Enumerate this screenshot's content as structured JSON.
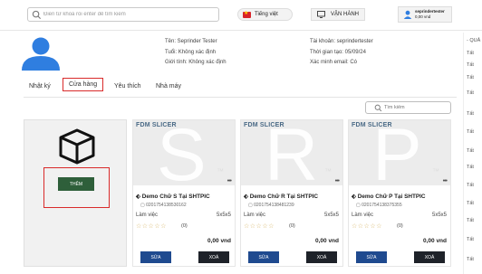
{
  "topbar": {
    "search_placeholder": "Điền từ khoá rồi enter để tìm kiếm",
    "language": "Tiếng việt",
    "operate": "VẬN HÀNH",
    "user_name": "seprindertester",
    "user_balance": "0,00 vnd"
  },
  "profile": {
    "name": "Tên: Seprinder Tester",
    "age": "Tuổi: Không xác định",
    "gender": "Giới tính: Không xác định",
    "account": "Tài khoản: seprindertester",
    "created": "Thời gian tạo: 05/09/24",
    "email_verified": "Xác minh email: Có"
  },
  "right_sidebar": {
    "header": "- QUẢ",
    "items": [
      "Tất",
      "Tất",
      "Tất",
      "Tất",
      "Tất",
      "Tất",
      "Tất",
      "Tất",
      "Tất",
      "Tất",
      "Tất",
      "Tất",
      "Tất"
    ]
  },
  "tabs": [
    "Nhật ký",
    "Cửa hàng",
    "Yêu thích",
    "Nhà máy"
  ],
  "store_search_placeholder": "Tìm kiếm",
  "add_button": "THÊM",
  "products": [
    {
      "brand": "FDM SLICER",
      "letter": "S",
      "title": "Demo Chữ S Tại SHTPIC",
      "code": "0201754138530162",
      "status": "Làm việc",
      "size": "5x5x5",
      "rating_count": "(0)",
      "price": "0,00 vnd",
      "edit": "SỬA",
      "delete": "XOÁ"
    },
    {
      "brand": "FDM SLICER",
      "letter": "R",
      "title": "Demo Chữ R Tại SHTPIC",
      "code": "0201754138481239",
      "status": "Làm việc",
      "size": "5x5x5",
      "rating_count": "(0)",
      "price": "0,00 vnd",
      "edit": "SỬA",
      "delete": "XOÁ"
    },
    {
      "brand": "FDM SLICER",
      "letter": "P",
      "title": "Demo Chữ P Tại SHTPIC",
      "code": "0201754138375355",
      "status": "Làm việc",
      "size": "5x5x5",
      "rating_count": "(0)",
      "price": "0,00 vnd",
      "edit": "SỬA",
      "delete": "XOÁ"
    }
  ],
  "colors": {
    "add_button": "#2e5f3a",
    "edit_button": "#1f4a8f",
    "delete_button": "#1e2229",
    "highlight": "#d92a2a",
    "avatar": "#2f7ee0"
  }
}
